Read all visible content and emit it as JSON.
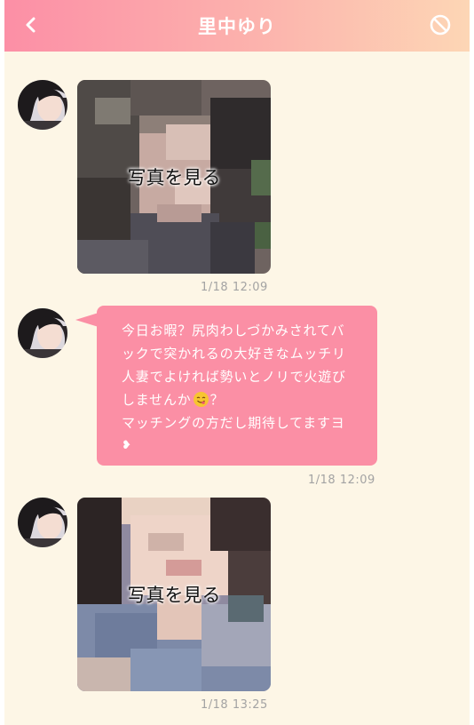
{
  "header": {
    "title": "里中ゆり",
    "back_icon": "chevron-left-icon",
    "block_icon": "block-icon",
    "gradient": [
      "#fc8fa6",
      "#fdd6b5"
    ]
  },
  "colors": {
    "background": "#fdf6e6",
    "bubble": "#fb8fa5",
    "timestamp": "#a3a3a3"
  },
  "messages": [
    {
      "type": "photo",
      "label": "写真を見る",
      "time": "1/18 12:09"
    },
    {
      "type": "text",
      "lines": [
        "今日お暇？尻肉わしづかみされてバ",
        "ックで突かれるの大好きなムッチリ",
        "人妻でよければ勢いとノリで火遊び",
        "しませんか",
        "？",
        "マッチングの方だし期待してますヨ",
        "❥"
      ],
      "emoji": "smiling-face-with-tongue-emoji",
      "time": "1/18 12:09"
    },
    {
      "type": "photo",
      "label": "写真を見る",
      "time": "1/18 13:25"
    }
  ]
}
